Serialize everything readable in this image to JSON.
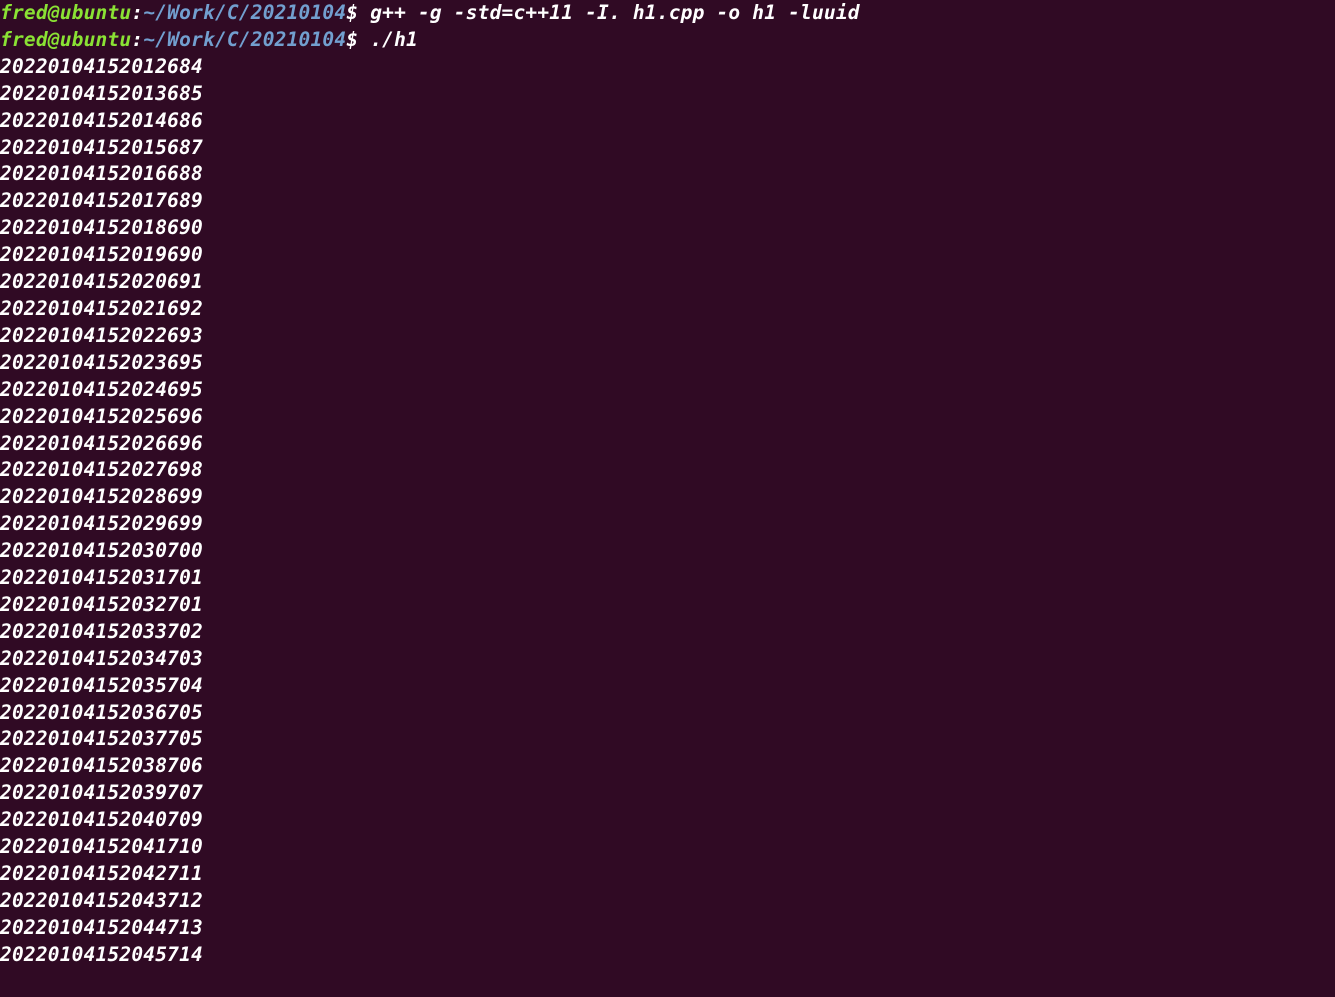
{
  "prompt": {
    "user": "fred",
    "at": "@",
    "host": "ubuntu",
    "colon": ":",
    "path": "~/Work/C/20210104",
    "dollar": "$"
  },
  "lines": [
    {
      "type": "prompt",
      "command": "g++ -g -std=c++11 -I. h1.cpp -o h1 -luuid"
    },
    {
      "type": "prompt",
      "command": "./h1"
    },
    {
      "type": "output",
      "text": "20220104152012684"
    },
    {
      "type": "output",
      "text": "20220104152013685"
    },
    {
      "type": "output",
      "text": "20220104152014686"
    },
    {
      "type": "output",
      "text": "20220104152015687"
    },
    {
      "type": "output",
      "text": "20220104152016688"
    },
    {
      "type": "output",
      "text": "20220104152017689"
    },
    {
      "type": "output",
      "text": "20220104152018690"
    },
    {
      "type": "output",
      "text": "20220104152019690"
    },
    {
      "type": "output",
      "text": "20220104152020691"
    },
    {
      "type": "output",
      "text": "20220104152021692"
    },
    {
      "type": "output",
      "text": "20220104152022693"
    },
    {
      "type": "output",
      "text": "20220104152023695"
    },
    {
      "type": "output",
      "text": "20220104152024695"
    },
    {
      "type": "output",
      "text": "20220104152025696"
    },
    {
      "type": "output",
      "text": "20220104152026696"
    },
    {
      "type": "output",
      "text": "20220104152027698"
    },
    {
      "type": "output",
      "text": "20220104152028699"
    },
    {
      "type": "output",
      "text": "20220104152029699"
    },
    {
      "type": "output",
      "text": "20220104152030700"
    },
    {
      "type": "output",
      "text": "20220104152031701"
    },
    {
      "type": "output",
      "text": "20220104152032701"
    },
    {
      "type": "output",
      "text": "20220104152033702"
    },
    {
      "type": "output",
      "text": "20220104152034703"
    },
    {
      "type": "output",
      "text": "20220104152035704"
    },
    {
      "type": "output",
      "text": "20220104152036705"
    },
    {
      "type": "output",
      "text": "20220104152037705"
    },
    {
      "type": "output",
      "text": "20220104152038706"
    },
    {
      "type": "output",
      "text": "20220104152039707"
    },
    {
      "type": "output",
      "text": "20220104152040709"
    },
    {
      "type": "output",
      "text": "20220104152041710"
    },
    {
      "type": "output",
      "text": "20220104152042711"
    },
    {
      "type": "output",
      "text": "20220104152043712"
    },
    {
      "type": "output",
      "text": "20220104152044713"
    },
    {
      "type": "output",
      "text": "20220104152045714"
    }
  ]
}
